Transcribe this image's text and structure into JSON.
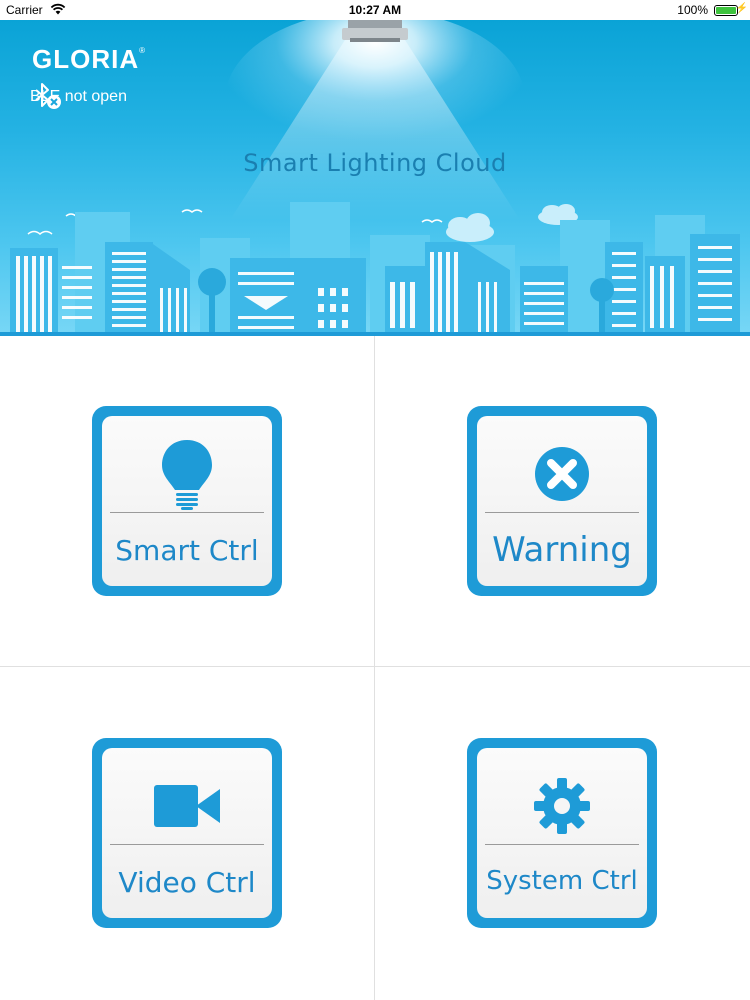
{
  "status_bar": {
    "carrier": "Carrier",
    "time": "10:27 AM",
    "battery": "100%"
  },
  "header": {
    "brand": "GLORIA",
    "brand_mark": "®",
    "ble_status": "BLE not open",
    "tagline": "Smart Lighting Cloud"
  },
  "tiles": [
    {
      "label": "Smart Ctrl",
      "icon": "lightbulb-icon"
    },
    {
      "label": "Warning",
      "icon": "close-circle-icon"
    },
    {
      "label": "Video Ctrl",
      "icon": "video-camera-icon"
    },
    {
      "label": "System Ctrl",
      "icon": "gear-icon"
    }
  ],
  "colors": {
    "accent": "#1e9bd7",
    "label": "#1e88c8",
    "banner_top": "#0aa3d6",
    "banner_bottom": "#78d7f6"
  }
}
